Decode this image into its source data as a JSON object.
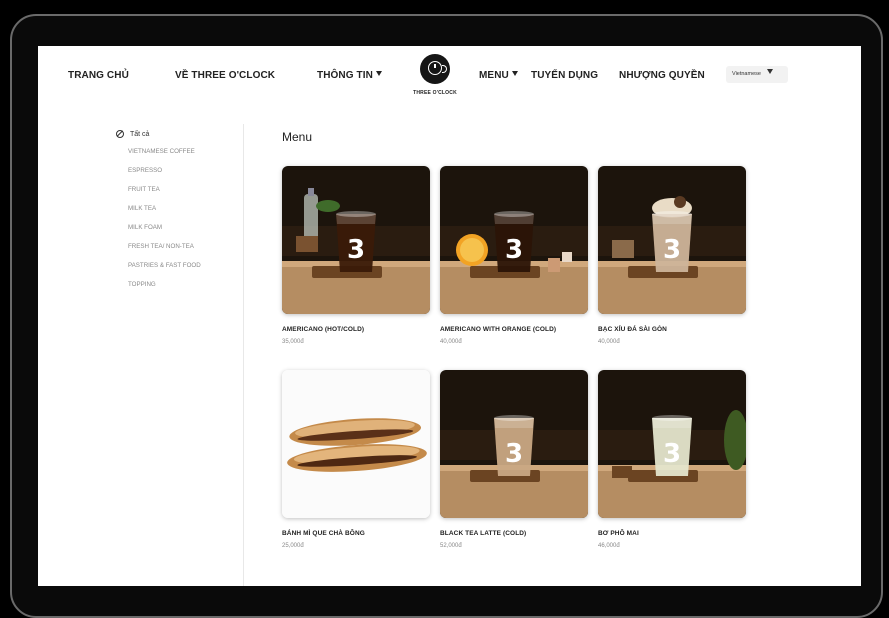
{
  "nav": {
    "home": "TRANG CHỦ",
    "about": "VỀ THREE O'CLOCK",
    "info": "THÔNG TIN",
    "logo_text": "THREE O'CLOCK",
    "menu": "MENU",
    "careers": "TUYỂN DỤNG",
    "franchise": "NHƯỢNG QUYỀN",
    "language": "Vietnamese"
  },
  "sidebar": {
    "all": "Tất cả",
    "items": [
      "VIETNAMESE COFFEE",
      "ESPRESSO",
      "FRUIT TEA",
      "MILK TEA",
      "MILK FOAM",
      "FRESH TEA/ NON-TEA",
      "PASTRIES & FAST FOOD",
      "TOPPING"
    ]
  },
  "main": {
    "title": "Menu",
    "products": [
      {
        "name": "AMERICANO (HOT/COLD)",
        "price": "35,000đ",
        "drink": "#3a1a08",
        "prop": "bottle"
      },
      {
        "name": "AMERICANO WITH ORANGE (COLD)",
        "price": "40,000đ",
        "drink": "#2b1407",
        "prop": "orange"
      },
      {
        "name": "BẠC XỈU ĐÁ SÀI GÒN",
        "price": "40,000đ",
        "drink": "#cdb49a",
        "prop": "cream"
      },
      {
        "name": "BÁNH MÌ QUE CHÀ BÔNG",
        "price": "25,000đ",
        "drink": "",
        "prop": "bread"
      },
      {
        "name": "BLACK TEA LATTE (COLD)",
        "price": "52,000đ",
        "drink": "#c9a884",
        "prop": "none"
      },
      {
        "name": "BƠ PHÔ MAI",
        "price": "46,000đ",
        "drink": "#e4e5cc",
        "prop": "plant"
      }
    ]
  },
  "colors": {
    "accent": "#222222",
    "photo_bg": "#1a1208",
    "table": "#a6805a"
  }
}
